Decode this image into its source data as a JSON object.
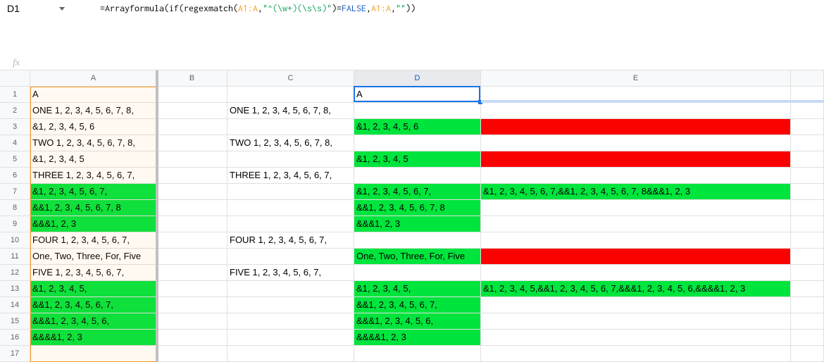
{
  "nameBox": "D1",
  "formula": {
    "prefix": "=",
    "fn1": "Arrayformula",
    "paren1": "(",
    "fn2": "if",
    "paren2": "(",
    "fn3": "regexmatch",
    "paren3": "(",
    "ref1": "A1:A",
    "comma1": ",",
    "str1": "\"^(\\w+)(\\s\\s)\"",
    "paren4": ")",
    "eq": "=",
    "false": "FALSE",
    "comma2": ",",
    "ref2": "A1:A",
    "comma3": ",",
    "str2": "\"\"",
    "paren5": "))"
  },
  "columns": [
    "A",
    "B",
    "C",
    "D",
    "E",
    ""
  ],
  "colWidths": [
    "wA",
    "wB",
    "wC",
    "wD",
    "wE",
    "wF"
  ],
  "rowCount": 17,
  "rows": [
    {
      "A": {
        "v": "A"
      },
      "D": {
        "v": "A"
      }
    },
    {
      "A": {
        "v": "ONE  1, 2, 3, 4, 5, 6, 7, 8,"
      },
      "C": {
        "v": "ONE  1, 2, 3, 4, 5, 6, 7, 8,"
      }
    },
    {
      "A": {
        "v": "&1, 2, 3, 4, 5, 6"
      },
      "D": {
        "v": "&1, 2, 3, 4, 5, 6",
        "bg": "green"
      },
      "E": {
        "v": "",
        "bg": "red"
      }
    },
    {
      "A": {
        "v": "TWO  1, 2, 3, 4, 5, 6, 7, 8,"
      },
      "C": {
        "v": "TWO  1, 2, 3, 4, 5, 6, 7, 8,"
      }
    },
    {
      "A": {
        "v": "&1, 2, 3, 4, 5"
      },
      "D": {
        "v": "&1, 2, 3, 4, 5",
        "bg": "green"
      },
      "E": {
        "v": "",
        "bg": "red"
      }
    },
    {
      "A": {
        "v": "THREE  1, 2, 3, 4, 5, 6, 7,"
      },
      "C": {
        "v": "THREE  1, 2, 3, 4, 5, 6, 7,"
      }
    },
    {
      "A": {
        "v": "&1, 2, 3, 4, 5, 6, 7,",
        "bg": "green"
      },
      "D": {
        "v": "&1, 2, 3, 4, 5, 6, 7,",
        "bg": "green"
      },
      "E": {
        "v": "&1, 2, 3, 4, 5, 6, 7,&&1, 2, 3, 4, 5, 6, 7, 8&&&1, 2, 3",
        "bg": "green"
      }
    },
    {
      "A": {
        "v": "&&1, 2, 3, 4, 5, 6, 7, 8",
        "bg": "green"
      },
      "D": {
        "v": "&&1, 2, 3, 4, 5, 6, 7, 8",
        "bg": "green"
      }
    },
    {
      "A": {
        "v": "&&&1, 2, 3",
        "bg": "green"
      },
      "D": {
        "v": "&&&1, 2, 3",
        "bg": "green"
      }
    },
    {
      "A": {
        "v": "FOUR  1, 2, 3, 4, 5, 6, 7,"
      },
      "C": {
        "v": "FOUR  1, 2, 3, 4, 5, 6, 7,"
      }
    },
    {
      "A": {
        "v": "One, Two, Three, For, Five"
      },
      "D": {
        "v": "One, Two, Three, For, Five",
        "bg": "green"
      },
      "E": {
        "v": "",
        "bg": "red"
      }
    },
    {
      "A": {
        "v": "FIVE  1, 2, 3, 4, 5, 6, 7,"
      },
      "C": {
        "v": "FIVE  1, 2, 3, 4, 5, 6, 7,"
      }
    },
    {
      "A": {
        "v": "&1, 2, 3, 4, 5,",
        "bg": "green"
      },
      "D": {
        "v": "&1, 2, 3, 4, 5,",
        "bg": "green"
      },
      "E": {
        "v": "&1, 2, 3, 4, 5,&&1, 2, 3, 4, 5, 6, 7,&&&1, 2, 3, 4, 5, 6,&&&&1, 2, 3",
        "bg": "green"
      }
    },
    {
      "A": {
        "v": "&&1, 2, 3, 4, 5, 6, 7,",
        "bg": "green"
      },
      "D": {
        "v": "&&1, 2, 3, 4, 5, 6, 7,",
        "bg": "green"
      }
    },
    {
      "A": {
        "v": "&&&1, 2, 3, 4, 5, 6,",
        "bg": "green"
      },
      "D": {
        "v": "&&&1, 2, 3, 4, 5, 6,",
        "bg": "green"
      }
    },
    {
      "A": {
        "v": "&&&&1, 2, 3",
        "bg": "green"
      },
      "D": {
        "v": "&&&&1, 2, 3",
        "bg": "green"
      }
    },
    {}
  ],
  "activeCell": {
    "col": "D",
    "row": 1
  }
}
